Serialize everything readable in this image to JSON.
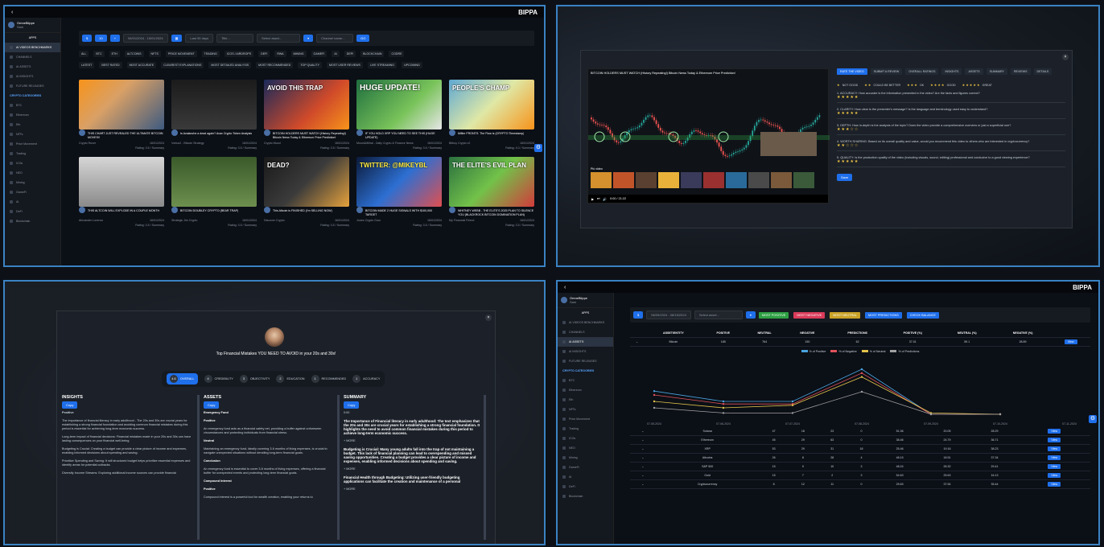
{
  "p1": {
    "brand": "BIPPA",
    "user": {
      "name": "OmneBlippe",
      "sub": "Sam"
    },
    "tab_label": "APPS",
    "nav": [
      "AI VIDEOS BENCHMARKS",
      "CHANNELS",
      "AI ASSETS",
      "AI INSIGHTS",
      "FUTURE RELEASES"
    ],
    "cat_title": "CRYPTO CATEGORIES",
    "cats": [
      "BTC",
      "Ethereum",
      "Eth",
      "NFTs",
      "Price Movement",
      "Trading",
      "ICOs",
      "NEO",
      "Mining",
      "GameFi",
      "AI",
      "DeFi",
      "Blockchain"
    ],
    "filters": {
      "date": "06/01/2024 - 15/01/2024",
      "days": "Last 90 days",
      "title": "Title...",
      "select": "Select asset...",
      "channel": "Channel name...",
      "go": "GO"
    },
    "chips": [
      "ALL",
      "BTC",
      "ETH",
      "Altcoins",
      "NFTs",
      "Price movement",
      "Trading",
      "ICOs / AirDrops",
      "DeFi",
      "RWA",
      "Mining",
      "GameFi",
      "AI",
      "DePi",
      "Blockchain",
      "CoDRE"
    ],
    "sort": [
      "LATEST",
      "BEST RATED",
      "MOST ACCURATE",
      "CLEAREST EXPLANATIONS",
      "MOST DETAILED ANALYSIS",
      "MOST RECOMMENDED",
      "TOP QUALITY",
      "MOST USER REVIEWS",
      "LIVE STREAMING",
      "UPCOMING"
    ],
    "cards": [
      {
        "title": "THIS CHART JUST REVEALED THE ULTIMATE BITCOIN MOVES!!",
        "channel": "Crypto Rover",
        "date": "16/01/2024",
        "rating": "Rating: 3.6 / Summary"
      },
      {
        "title": "Is Avalanche a dead again? Avax Crypto Token Analysis",
        "channel": "Vortus2 - Bitcoin Strategy",
        "date": "16/01/2024",
        "rating": "Rating: 3.5 / Summary"
      },
      {
        "title": "BITCOIN HOLDERS MUST WATCH (History Repeating!) Bitcoin News Today & Ethereum Price Prediction!",
        "channel": "Crypto Mood",
        "date": "16/01/2024",
        "rating": "Rating: 3.5 / Summary"
      },
      {
        "title": "IF YOU HOLD XRP YOU NEED TO SEE THIS (HUGE UPDATE)",
        "channel": "Moon&Milhal - Daily Crypto & Finance News",
        "date": "16/01/2024",
        "rating": "Rating: 3.5 / Summary"
      },
      {
        "title": "Millier FRONTS: The Flow is (CRYPTO Timestamp)",
        "channel": "Bitboy Crypto v2",
        "date": "16/01/2024",
        "rating": "Rating: 4.0 / Summary"
      },
      {
        "title": "THIS ALTCOIN WILL EXPLODE IN A COUPLE MONTH",
        "channel": "Alexander Lorenzo",
        "date": "16/01/2024",
        "rating": "Rating: 3.5 / Summary"
      },
      {
        "title": "BITCOIN DOUBLEY CRYPTO (BEAR TRAP)",
        "channel": "Strategic Jim Crypto",
        "date": "16/01/2024",
        "rating": "Rating: 3.5 / Summary"
      },
      {
        "title": "This Altcoin is FINISHED (I'm SELLING NOW)",
        "channel": "Discover Crypto",
        "date": "16/01/2024",
        "rating": "Rating: 3.5 / Summary"
      },
      {
        "title": "BITCOIN MADE 2 HUGE SIGNALS WITH $100,000 TARGET",
        "channel": "Jones Crypto Guru",
        "date": "16/01/2024",
        "rating": "Rating: 3.5 / Summary"
      },
      {
        "title": "WHITNEY WEBB - THE ELITE'S 2025 PLAN TO SILENCE YOU (BLACKROCK BITCOIN DOMINATION PLAN)",
        "channel": "My Financial Friend",
        "date": "16/01/2024",
        "rating": "Rating: 3.5 / Summary"
      }
    ],
    "thumb_texts": [
      "",
      "",
      "AVOID THIS TRAP",
      "HUGE UPDATE!",
      "PEOPLE'S CHAMP",
      "",
      "",
      "DEAD?",
      "TWITTER: @MIKEYBL",
      "THE ELITE'S EVIL PLAN"
    ]
  },
  "p2": {
    "video_title": "BITCOIN HOLDERS MUST WATCH (History Repeating!) Bitcoin News Today & Ethereum Price Prediction!",
    "time": "0:00 / 21:22",
    "tabs": [
      "RATE THE VIDEO",
      "SUBMIT A REVIEW",
      "OVERALL RATINGS",
      "INSIGHTS",
      "ASSETS",
      "SUMMARY",
      "REVIEWS",
      "DETAILS"
    ],
    "legend": [
      "NOT GOOD",
      "COULD BE BETTER",
      "OK",
      "GOOD",
      "GREAT"
    ],
    "questions": [
      "1. ACCURACY: How accurate is the information presented in the video? Are the facts and figures correct?",
      "2. CLARITY: How clear is the presenter's message? Is the language and terminology used easy to understand?",
      "3. DEPTH: How in-depth is the analysis of the topic? Does the video provide a comprehensive overview or just a superficial one?",
      "4. WORTH SHARING: Based on its overall quality and value, would you recommend this video to others who are interested in cryptocurrency?",
      "5. QUALITY: Is the production quality of the video (including visuals, sound, editing) professional and conducive to a good viewing experience?"
    ],
    "stars": [
      "★★★★★",
      "★★★★★",
      "★★★☆☆",
      "★★☆☆☆",
      "★★★★★"
    ],
    "save": "Save",
    "related": "Più video"
  },
  "p3": {
    "title": "Top Financial Mistakes YOU NEED TO AVOID in your 20s and 30s!",
    "scores": [
      {
        "v": "4.6",
        "l": "OVERALL"
      },
      {
        "v": "4",
        "l": "CREDIBILITY"
      },
      {
        "v": "3",
        "l": "OBJECTIVITY"
      },
      {
        "v": "2",
        "l": "EDUCATION"
      },
      {
        "v": "1",
        "l": "RECOMMENDED"
      },
      {
        "v": "1",
        "l": "ACCURACY"
      }
    ],
    "insights_h": "INSIGHTS",
    "assets_h": "ASSETS",
    "summary_h": "SUMMARY",
    "copy": "Copy",
    "insights": [
      "Positive",
      "The importance of financial literacy in early adulthood - The 20s and 30s are crucial years for establishing a strong financial foundation and avoiding common financial mistakes during this period is essential for achieving long-term economic success.",
      "Long-term impact of financial decisions: Financial mistakes made in your 20s and 30s can have lasting consequences on your financial well-being.",
      "Budgeting is Crucial: Creating a budget can provide a clear picture of income and expenses, enabling informed decisions about spending and saving.",
      "Prioritize Spending and Saving: It will structured budget helps prioritize essential expenses and identify areas for potential cutbacks.",
      "Diversify Income Streams: Exploring additional income sources can provide financial"
    ],
    "assets": [
      "Emergency Fund",
      "Positive",
      "An emergency fund acts as a financial safety net, providing a buffer against unforeseen circumstances and protecting individuals from financial stress.",
      "Neutral",
      "Maintaining an emergency fund, ideally covering 3-6 months of living expenses, is crucial to navigate unexpected situations without derailing long-term financial goals.",
      "Conclusion",
      "An emergency fund is essential to cover 3-6 months of living expenses, offering a financial buffer for unexpected events and protecting long-term financial goals.",
      "Compound Interest",
      "Positive",
      "Compound interest is a powerful tool for wealth creation, enabling your returns to"
    ],
    "summary": [
      "The Importance of Financial literacy in early adulthood:  The text emphasizes that the 20s and 30s are crucial years for establishing a strong financial foundation. It highlights the need to avoid common financial mistakes during this period to achieve long-term economic success.",
      "Budgeting is Crucial:  Many young adults fall into the trap of not maintaining a budget. This lack of financial planning can lead to overspending and missed saving opportunities. Creating a budget provides a clear picture of income and expenses, enabling informed decisions about spending and saving.",
      "Financial Health through Budgeting: Utilizing user-friendly budgeting applications can facilitate the creation and maintenance of a personal"
    ],
    "tag1": "0:00",
    "more": "+ MORE"
  },
  "p4": {
    "brand": "BIPPA",
    "filters": {
      "date": "06/09/2024 - 08/15/2024",
      "select": "Select asset...",
      "b1": "MOST POSITIVE",
      "b2": "MOST NEGATIVE",
      "b3": "MOST NEUTRAL",
      "b4": "MOST PREDICTIONS",
      "b5": "CHECK BALANCE"
    },
    "headers": [
      "ASSET/ENTITY",
      "POSITIVE",
      "NEUTRAL",
      "NEGATIVE",
      "PREDICTIONS",
      "POSITIVE (%)",
      "NEUTRAL (%)",
      "NEGATIVE (%)"
    ],
    "rows": [
      [
        "Bitcoin",
        "185",
        "764",
        "150",
        "62",
        "37.01",
        "59.1",
        "28.89"
      ],
      [
        "Solana",
        "47",
        "18",
        "23",
        "0",
        "51.06",
        "20.05",
        "28.29"
      ],
      [
        "Ethereum",
        "45",
        "29",
        "63",
        "0",
        "38.46",
        "24.79",
        "36.71"
      ],
      [
        "XRP",
        "53",
        "29",
        "31",
        "18",
        "25.46",
        "19.16",
        "38.23"
      ],
      [
        "Altcoins",
        "26",
        "8",
        "28",
        "4",
        "48.15",
        "18.51",
        "37.34"
      ],
      [
        "S&P 500",
        "15",
        "9",
        "10",
        "3",
        "48.24",
        "26.32",
        "29.41"
      ],
      [
        "Gold",
        "15",
        "7",
        "2",
        "3",
        "54.63",
        "25.63",
        "16.13"
      ],
      [
        "Cryptocurrency",
        "8",
        "12",
        "11",
        "0",
        "25.63",
        "37.54",
        "35.44"
      ]
    ],
    "view": "View",
    "legend": [
      "% of Positive",
      "% of Negative",
      "% of Neutral",
      "% of Predictions"
    ],
    "dates": [
      "07-05-2024",
      "07-06-2024",
      "07-07-2024",
      "07-08-2024",
      "07-09-2024",
      "07-10-2024",
      "07-11-2024"
    ]
  }
}
